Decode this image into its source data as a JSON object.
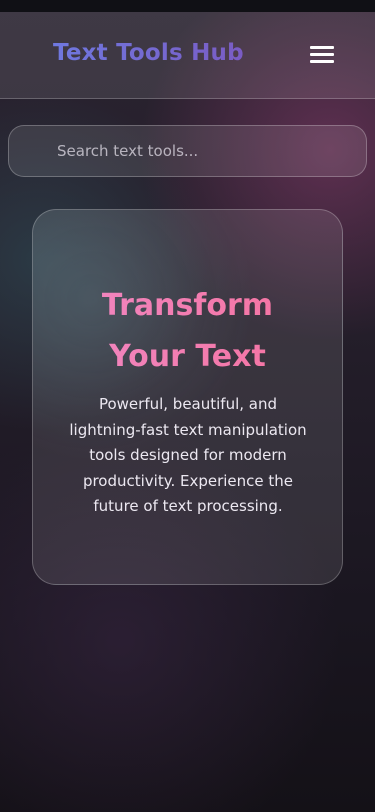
{
  "header": {
    "logo": "Text Tools Hub",
    "menu_icon": "hamburger-menu-icon"
  },
  "search": {
    "placeholder": "Search text tools...",
    "value": ""
  },
  "hero": {
    "title_line1": "Transform",
    "title_line2": "Your Text",
    "description": "Powerful, beautiful, and lightning-fast text manipulation tools designed for modern productivity. Experience the future of text processing."
  },
  "colors": {
    "logo_gradient_start": "#6f78e0",
    "logo_gradient_end": "#7a5cc4",
    "hero_title_gradient_start": "#f08ac6",
    "hero_title_gradient_end": "#f5709c"
  }
}
